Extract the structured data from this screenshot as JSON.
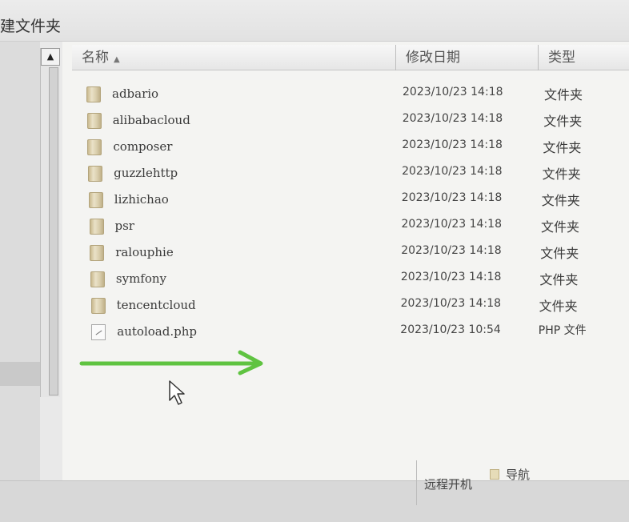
{
  "toolbar": {
    "new_folder_label": "建文件夹"
  },
  "columns": {
    "name": "名称",
    "date": "修改日期",
    "type": "类型",
    "sort_indicator": "▲"
  },
  "scrollbar": {
    "up_glyph": "▲"
  },
  "files": [
    {
      "name": "adbario",
      "date": "2023/10/23 14:18",
      "type": "文件夹",
      "icon": "folder-icon"
    },
    {
      "name": "alibabacloud",
      "date": "2023/10/23 14:18",
      "type": "文件夹",
      "icon": "folder-icon"
    },
    {
      "name": "composer",
      "date": "2023/10/23 14:18",
      "type": "文件夹",
      "icon": "folder-icon"
    },
    {
      "name": "guzzlehttp",
      "date": "2023/10/23 14:18",
      "type": "文件夹",
      "icon": "folder-icon"
    },
    {
      "name": "lizhichao",
      "date": "2023/10/23 14:18",
      "type": "文件夹",
      "icon": "folder-icon"
    },
    {
      "name": "psr",
      "date": "2023/10/23 14:18",
      "type": "文件夹",
      "icon": "folder-icon"
    },
    {
      "name": "ralouphie",
      "date": "2023/10/23 14:18",
      "type": "文件夹",
      "icon": "folder-icon"
    },
    {
      "name": "symfony",
      "date": "2023/10/23 14:18",
      "type": "文件夹",
      "icon": "folder-icon"
    },
    {
      "name": "tencentcloud",
      "date": "2023/10/23 14:18",
      "type": "文件夹",
      "icon": "folder-icon"
    },
    {
      "name": "autoload.php",
      "date": "2023/10/23 10:54",
      "type": "PHP 文件",
      "icon": "php-file-icon"
    }
  ],
  "statusbar": {
    "remote_label": "远程开机",
    "nav_label": "导航"
  },
  "colors": {
    "arrow": "#5fc341",
    "header_bg": "#ececec",
    "pane_bg": "#f4f4f2"
  }
}
